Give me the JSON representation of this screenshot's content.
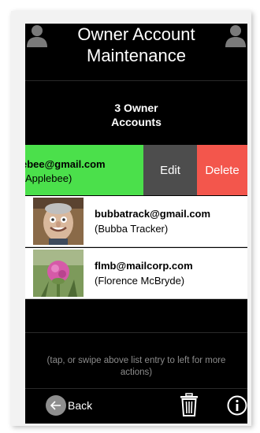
{
  "header": {
    "title": "Owner Account\nMaintenance",
    "left_icon": "person-icon",
    "right_icon": "person-icon"
  },
  "summary": {
    "count_label": "3 Owner\nAccounts"
  },
  "accounts": [
    {
      "email": "ebee@gmail.com",
      "name": "Applebee)",
      "swiped": true,
      "highlight_color": "#4be04b",
      "actions": {
        "edit_label": "Edit",
        "delete_label": "Delete"
      }
    },
    {
      "email": "bubbatrack@gmail.com",
      "name": "(Bubba Tracker)",
      "avatar": "bubba-photo"
    },
    {
      "email": "flmb@mailcorp.com",
      "name": "(Florence McBryde)",
      "avatar": "thistle-photo"
    }
  ],
  "hint": "(tap, or swipe above list entry to left for more actions)",
  "footer": {
    "back_label": "Back",
    "trash_icon": "trash-icon",
    "info_icon": "info-icon"
  },
  "colors": {
    "edit": "#4d4d4d",
    "delete": "#f3564c"
  }
}
